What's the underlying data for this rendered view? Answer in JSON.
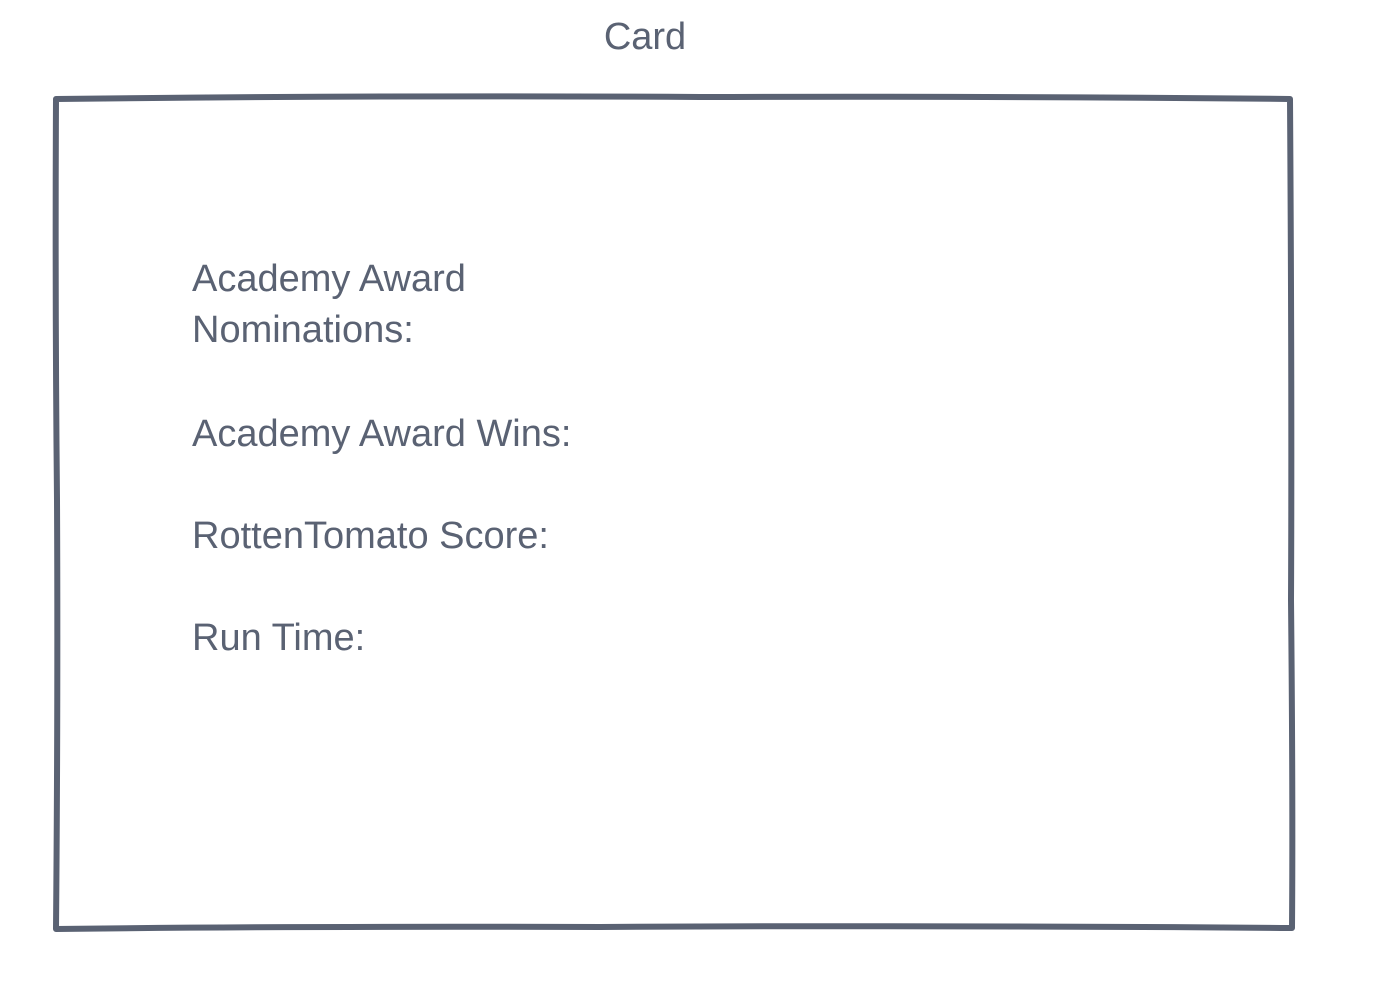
{
  "card": {
    "title": "Card",
    "fields": [
      {
        "label": "Academy Award Nominations:"
      },
      {
        "label": "Academy Award Wins:"
      },
      {
        "label": "RottenTomato Score:"
      },
      {
        "label": "Run Time:"
      }
    ],
    "border_color": "#5a6273",
    "text_color": "#5a6273"
  }
}
